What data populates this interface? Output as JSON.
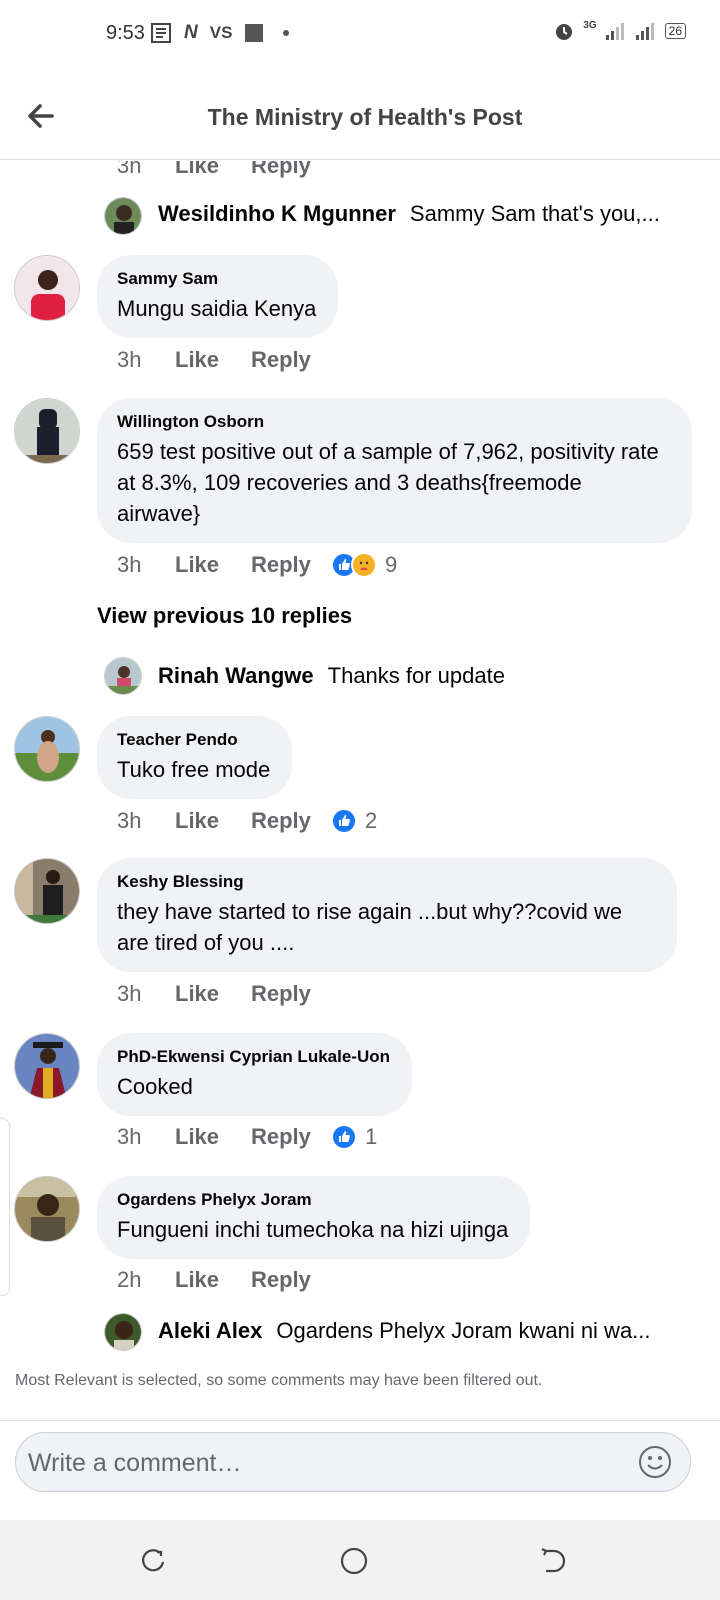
{
  "status_bar": {
    "time": "9:53",
    "left_icons": [
      "notes-icon",
      "N",
      "VS",
      "square-icon",
      "dot-icon"
    ],
    "network": "3G",
    "battery": "26"
  },
  "header": {
    "title": "The Ministry of Health's Post",
    "back_icon": "back-arrow-icon"
  },
  "partial_top": {
    "time": "3h",
    "like": "Like",
    "reply": "Reply"
  },
  "threads": [
    {
      "type": "inline",
      "name": "Wesildinho K Mgunner",
      "text": "Sammy Sam that's you,..."
    },
    {
      "type": "comment",
      "name": "Sammy Sam",
      "text": "Mungu saidia Kenya",
      "time": "3h",
      "like": "Like",
      "reply": "Reply"
    },
    {
      "type": "comment",
      "name": "Willington Osborn",
      "text": "659 test positive out of a sample of 7,962, positivity rate at 8.3%,  109 recoveries  and 3 deaths{freemode airwave}",
      "time": "3h",
      "like": "Like",
      "reply": "Reply",
      "reactions": [
        "like",
        "care"
      ],
      "reaction_count": "9"
    },
    {
      "type": "view_previous",
      "label": "View previous 10 replies"
    },
    {
      "type": "inline",
      "name": "Rinah Wangwe",
      "text": "Thanks for update"
    },
    {
      "type": "comment",
      "name": "Teacher Pendo",
      "text": "Tuko free mode",
      "time": "3h",
      "like": "Like",
      "reply": "Reply",
      "reactions": [
        "like"
      ],
      "reaction_count": "2"
    },
    {
      "type": "comment",
      "name": "Keshy Blessing",
      "text": "they have started to rise again ...but why??covid we are tired of you ....",
      "time": "3h",
      "like": "Like",
      "reply": "Reply"
    },
    {
      "type": "comment",
      "name": "PhD-Ekwensi Cyprian Lukale-Uon",
      "text": "Cooked",
      "time": "3h",
      "like": "Like",
      "reply": "Reply",
      "reactions": [
        "like"
      ],
      "reaction_count": "1"
    },
    {
      "type": "comment",
      "name": "Ogardens Phelyx Joram",
      "text": "Fungueni inchi tumechoka na hizi ujinga",
      "time": "2h",
      "like": "Like",
      "reply": "Reply"
    },
    {
      "type": "inline",
      "name": "Aleki Alex",
      "text": "Ogardens Phelyx Joram kwani ni wa..."
    }
  ],
  "filter_note": "Most Relevant is selected, so some comments may have been filtered out.",
  "composer": {
    "placeholder": "Write a comment…",
    "emoji_icon": "smiley-icon"
  },
  "nav": {
    "icons": [
      "recents-icon",
      "home-icon",
      "back-icon"
    ]
  },
  "colors": {
    "bubble": "#f0f2f5",
    "like_blue": "#1877f2",
    "muted": "#65676b"
  }
}
